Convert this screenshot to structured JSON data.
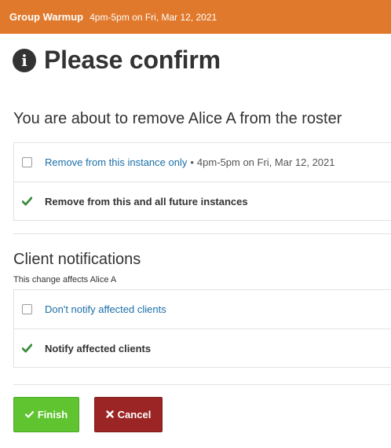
{
  "topbar": {
    "class_name": "Group Warmup",
    "class_time": "4pm-5pm on Fri, Mar 12, 2021",
    "color": "#e0792c"
  },
  "dialog": {
    "title": "Please confirm",
    "icon": "info-circle-icon"
  },
  "roster": {
    "heading": "You are about to remove Alice A from the roster",
    "options": [
      {
        "label": "Remove from this instance only",
        "detail": "4pm-5pm on Fri, Mar 12, 2021",
        "separator": "•",
        "selected": false
      },
      {
        "label": "Remove from this and all future instances",
        "selected": true
      }
    ]
  },
  "notifications": {
    "heading": "Client notifications",
    "subtext": "This change affects Alice A",
    "options": [
      {
        "label": "Don't notify affected clients",
        "selected": false
      },
      {
        "label": "Notify affected clients",
        "selected": true
      }
    ]
  },
  "buttons": {
    "finish": {
      "label": "Finish",
      "icon": "check-icon",
      "color": "#5fc42f"
    },
    "cancel": {
      "label": "Cancel",
      "icon": "x-icon",
      "color": "#9b2424"
    }
  }
}
